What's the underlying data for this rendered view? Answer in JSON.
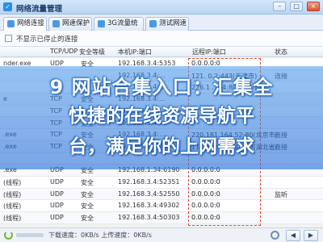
{
  "window": {
    "title": "网络流量管理"
  },
  "tabs": [
    {
      "label": "网络连接",
      "active": true
    },
    {
      "label": "网速保护",
      "active": false
    },
    {
      "label": "3G流量统计",
      "active": false
    },
    {
      "label": "测试网速",
      "active": false
    }
  ],
  "toolbar": {
    "checkbox_label": "不显示已停止的连接"
  },
  "table": {
    "columns": [
      "",
      "TCP/UDP",
      "安全等级",
      "本机IP:端口",
      "远程IP:端口",
      "状态"
    ],
    "rows": [
      {
        "process": "nder.exe",
        "proto": "UDP",
        "safety": "安全",
        "local": "192.168.3.4:5353",
        "remote": "0.0.0.0:0",
        "status": ""
      },
      {
        "process": "",
        "proto": "",
        "safety": "",
        "local": "192.168.3.4:...",
        "remote": "121. 0.2:443(天津市)",
        "status": "连接"
      },
      {
        "process": "",
        "proto": "",
        "safety": "",
        "local": "192.168.3.4:...",
        "remote": "226.1 .164:80(上海市)",
        "status": ""
      },
      {
        "process": "e",
        "proto": "TCP",
        "safety": "安全",
        "local": "192.168.3.4:...",
        "remote": "",
        "status": ""
      },
      {
        "process": "",
        "proto": "TCP",
        "safety": "安全",
        "local": "192.168.3.4:...",
        "remote": "",
        "status": ""
      },
      {
        "process": "",
        "proto": "TCP",
        "safety": "安全",
        "local": "192.168.3.4:...",
        "remote": "",
        "status": ""
      },
      {
        "process": ".exe",
        "proto": "TCP",
        "safety": "安全",
        "local": "192.168.3.4:...",
        "remote": "220.181.164.52:80(北京市)",
        "status": "连接"
      },
      {
        "process": ".exe",
        "proto": "TCP",
        "safety": "安全",
        "local": "192.168.3.4:49567",
        "remote": "116.211.117.48:80(湖北省)",
        "status": "连接"
      },
      {
        "process": "",
        "proto": "",
        "safety": "",
        "local": "",
        "remote": "",
        "status": ""
      },
      {
        "process": ".exe",
        "proto": "UDP",
        "safety": "安全",
        "local": "192.168.1.34:6190",
        "remote": "0.0.0.0:0",
        "status": ""
      },
      {
        "process": "(线程)",
        "proto": "UDP",
        "safety": "安全",
        "local": "192.168.3.4:52351",
        "remote": "0.0.0.0:0",
        "status": ""
      },
      {
        "process": "(线程)",
        "proto": "UDP",
        "safety": "安全",
        "local": "192.168.3.4:52550",
        "remote": "0.0.0.0:0",
        "status": "监听"
      },
      {
        "process": "(线程)",
        "proto": "UDP",
        "safety": "安全",
        "local": "192.168.3.4:49302",
        "remote": "0.0.0.0:0",
        "status": ""
      },
      {
        "process": "(线程)",
        "proto": "UDP",
        "safety": "安全",
        "local": "192.168.3.4:50303",
        "remote": "0.0.0.0:0",
        "status": ""
      }
    ]
  },
  "banner": {
    "line1": "9 网站合集入口：汇集全",
    "line2": "快捷的在线资源导航平",
    "line3": "台，满足你的上网需求"
  },
  "statusbar": {
    "text": "下载速度：0KB/s   上传速度：0KB/s"
  },
  "colors": {
    "highlight_box": "#e04b2a",
    "banner": "#3c8be6",
    "titlebar": "#b9d6f4"
  }
}
